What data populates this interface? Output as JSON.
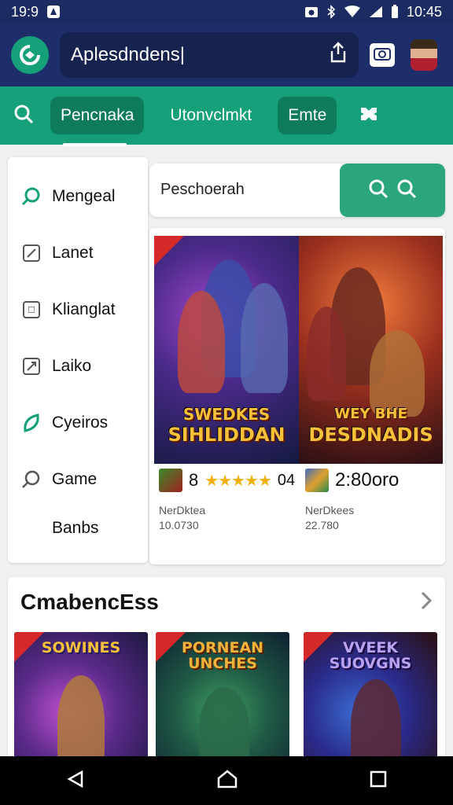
{
  "status_bar": {
    "time": "19:9",
    "right_time": "10:45",
    "icons": [
      "notification-icon",
      "camera-icon",
      "bluetooth-icon",
      "wifi-icon",
      "signal-icon",
      "battery-icon"
    ]
  },
  "header": {
    "url_text": "Aplesdndens|",
    "icons": [
      "logo-icon",
      "share-icon",
      "camera-icon",
      "avatar"
    ]
  },
  "tabs": [
    {
      "label": "Pencnaka",
      "active": true
    },
    {
      "label": "Utonvclmkt",
      "active": false
    },
    {
      "label": "Emte",
      "active": false
    }
  ],
  "sidebar": {
    "items": [
      {
        "label": "Mengeal",
        "icon": "search-icon"
      },
      {
        "label": "Lanet",
        "icon": "edit-icon"
      },
      {
        "label": "Klianglat",
        "icon": "square-icon"
      },
      {
        "label": "Laiko",
        "icon": "edit-icon"
      },
      {
        "label": "Cyeiros",
        "icon": "leaf-icon"
      },
      {
        "label": "Game",
        "icon": "search-icon"
      },
      {
        "label": "Banbs",
        "icon": ""
      }
    ]
  },
  "search": {
    "placeholder": "Peschoerah"
  },
  "featured": [
    {
      "title_line1": "SWEDKES",
      "title_line2": "SIHLIDDAN",
      "meta_left": "8",
      "stars": "★★★★★",
      "meta_right": "04",
      "sub1": "NerDktea",
      "sub2": "10.0730"
    },
    {
      "title_line1": "WEY BHE",
      "title_line2": "DESDNADIS",
      "meta_value": "2:80oro",
      "sub1": "NerDkees",
      "sub2": "22.780"
    }
  ],
  "section": {
    "title": "CmabencEss",
    "cards": [
      {
        "title": "SOWINES"
      },
      {
        "title": "PORNEAN UNCHES"
      },
      {
        "title": "VVEEK SUOVGNS"
      }
    ]
  },
  "colors": {
    "header_bg": "#1d2e6b",
    "tab_bar_bg": "#15a07a",
    "accent_green": "#2aa57e",
    "nav_bg": "#000000"
  }
}
